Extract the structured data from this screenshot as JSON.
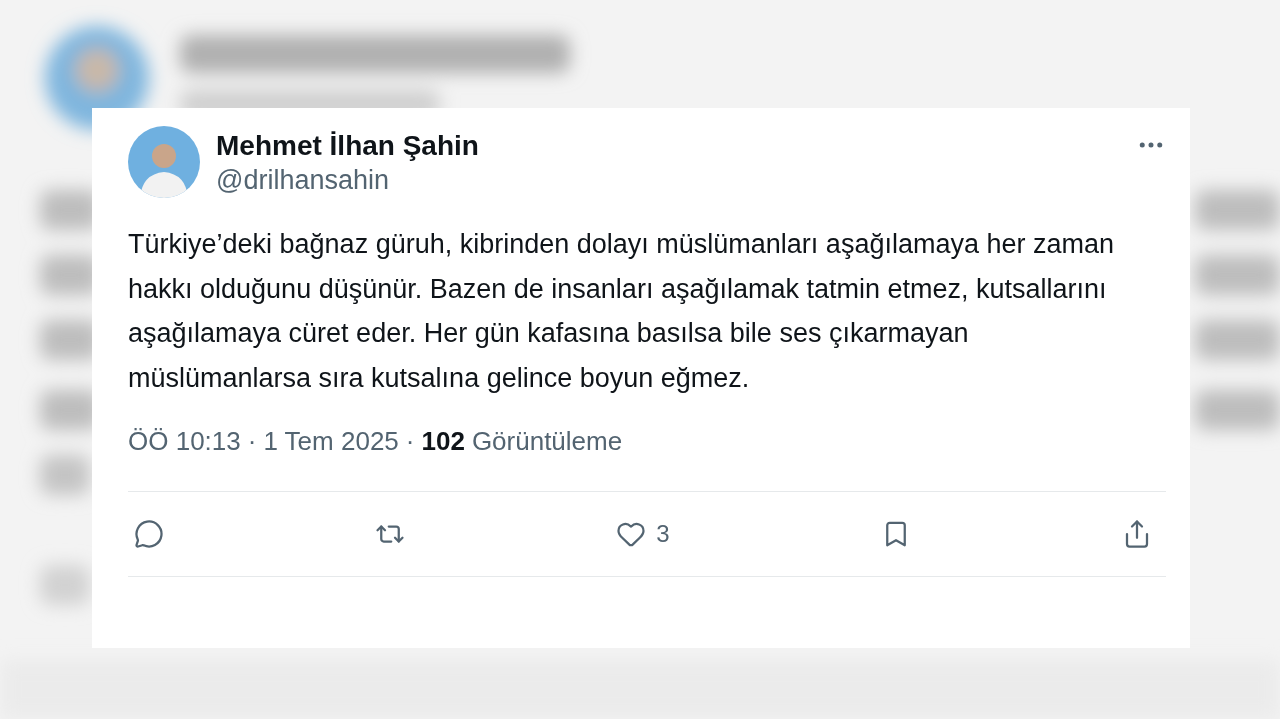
{
  "author": {
    "name": "Mehmet İlhan Şahin",
    "handle": "@drilhansahin"
  },
  "text": "Türkiye’deki bağnaz güruh, kibrinden dolayı müslümanları aşağılamaya her zaman hakkı olduğunu düşünür. Bazen de insanları aşağılamak tatmin etmez, kutsallarını aşağılamaya cüret eder. Her gün kafasına basılsa bile ses çıkarmayan müslümanlarsa sıra kutsalına gelince boyun eğmez.",
  "meta": {
    "time": "ÖÖ 10:13",
    "separator": "·",
    "date": "1 Tem 2025",
    "separator_2": "·",
    "views": "102",
    "views_label": "Görüntüleme"
  },
  "actions": [
    {
      "kind": "reply"
    },
    {
      "kind": "repost"
    },
    {
      "kind": "like",
      "count": "3"
    },
    {
      "kind": "bookmark"
    },
    {
      "kind": "share"
    }
  ]
}
